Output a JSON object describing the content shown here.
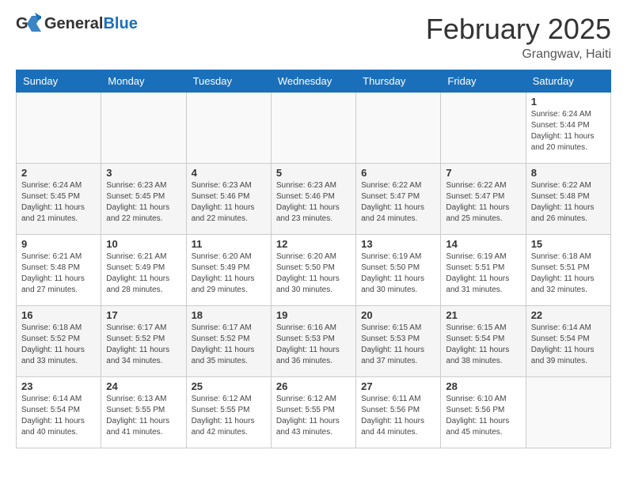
{
  "header": {
    "logo_general": "General",
    "logo_blue": "Blue",
    "title": "February 2025",
    "subtitle": "Grangwav, Haiti"
  },
  "days_of_week": [
    "Sunday",
    "Monday",
    "Tuesday",
    "Wednesday",
    "Thursday",
    "Friday",
    "Saturday"
  ],
  "weeks": [
    [
      {
        "day": "",
        "info": ""
      },
      {
        "day": "",
        "info": ""
      },
      {
        "day": "",
        "info": ""
      },
      {
        "day": "",
        "info": ""
      },
      {
        "day": "",
        "info": ""
      },
      {
        "day": "",
        "info": ""
      },
      {
        "day": "1",
        "info": "Sunrise: 6:24 AM\nSunset: 5:44 PM\nDaylight: 11 hours\nand 20 minutes."
      }
    ],
    [
      {
        "day": "2",
        "info": "Sunrise: 6:24 AM\nSunset: 5:45 PM\nDaylight: 11 hours\nand 21 minutes."
      },
      {
        "day": "3",
        "info": "Sunrise: 6:23 AM\nSunset: 5:45 PM\nDaylight: 11 hours\nand 22 minutes."
      },
      {
        "day": "4",
        "info": "Sunrise: 6:23 AM\nSunset: 5:46 PM\nDaylight: 11 hours\nand 22 minutes."
      },
      {
        "day": "5",
        "info": "Sunrise: 6:23 AM\nSunset: 5:46 PM\nDaylight: 11 hours\nand 23 minutes."
      },
      {
        "day": "6",
        "info": "Sunrise: 6:22 AM\nSunset: 5:47 PM\nDaylight: 11 hours\nand 24 minutes."
      },
      {
        "day": "7",
        "info": "Sunrise: 6:22 AM\nSunset: 5:47 PM\nDaylight: 11 hours\nand 25 minutes."
      },
      {
        "day": "8",
        "info": "Sunrise: 6:22 AM\nSunset: 5:48 PM\nDaylight: 11 hours\nand 26 minutes."
      }
    ],
    [
      {
        "day": "9",
        "info": "Sunrise: 6:21 AM\nSunset: 5:48 PM\nDaylight: 11 hours\nand 27 minutes."
      },
      {
        "day": "10",
        "info": "Sunrise: 6:21 AM\nSunset: 5:49 PM\nDaylight: 11 hours\nand 28 minutes."
      },
      {
        "day": "11",
        "info": "Sunrise: 6:20 AM\nSunset: 5:49 PM\nDaylight: 11 hours\nand 29 minutes."
      },
      {
        "day": "12",
        "info": "Sunrise: 6:20 AM\nSunset: 5:50 PM\nDaylight: 11 hours\nand 30 minutes."
      },
      {
        "day": "13",
        "info": "Sunrise: 6:19 AM\nSunset: 5:50 PM\nDaylight: 11 hours\nand 30 minutes."
      },
      {
        "day": "14",
        "info": "Sunrise: 6:19 AM\nSunset: 5:51 PM\nDaylight: 11 hours\nand 31 minutes."
      },
      {
        "day": "15",
        "info": "Sunrise: 6:18 AM\nSunset: 5:51 PM\nDaylight: 11 hours\nand 32 minutes."
      }
    ],
    [
      {
        "day": "16",
        "info": "Sunrise: 6:18 AM\nSunset: 5:52 PM\nDaylight: 11 hours\nand 33 minutes."
      },
      {
        "day": "17",
        "info": "Sunrise: 6:17 AM\nSunset: 5:52 PM\nDaylight: 11 hours\nand 34 minutes."
      },
      {
        "day": "18",
        "info": "Sunrise: 6:17 AM\nSunset: 5:52 PM\nDaylight: 11 hours\nand 35 minutes."
      },
      {
        "day": "19",
        "info": "Sunrise: 6:16 AM\nSunset: 5:53 PM\nDaylight: 11 hours\nand 36 minutes."
      },
      {
        "day": "20",
        "info": "Sunrise: 6:15 AM\nSunset: 5:53 PM\nDaylight: 11 hours\nand 37 minutes."
      },
      {
        "day": "21",
        "info": "Sunrise: 6:15 AM\nSunset: 5:54 PM\nDaylight: 11 hours\nand 38 minutes."
      },
      {
        "day": "22",
        "info": "Sunrise: 6:14 AM\nSunset: 5:54 PM\nDaylight: 11 hours\nand 39 minutes."
      }
    ],
    [
      {
        "day": "23",
        "info": "Sunrise: 6:14 AM\nSunset: 5:54 PM\nDaylight: 11 hours\nand 40 minutes."
      },
      {
        "day": "24",
        "info": "Sunrise: 6:13 AM\nSunset: 5:55 PM\nDaylight: 11 hours\nand 41 minutes."
      },
      {
        "day": "25",
        "info": "Sunrise: 6:12 AM\nSunset: 5:55 PM\nDaylight: 11 hours\nand 42 minutes."
      },
      {
        "day": "26",
        "info": "Sunrise: 6:12 AM\nSunset: 5:55 PM\nDaylight: 11 hours\nand 43 minutes."
      },
      {
        "day": "27",
        "info": "Sunrise: 6:11 AM\nSunset: 5:56 PM\nDaylight: 11 hours\nand 44 minutes."
      },
      {
        "day": "28",
        "info": "Sunrise: 6:10 AM\nSunset: 5:56 PM\nDaylight: 11 hours\nand 45 minutes."
      },
      {
        "day": "",
        "info": ""
      }
    ]
  ]
}
